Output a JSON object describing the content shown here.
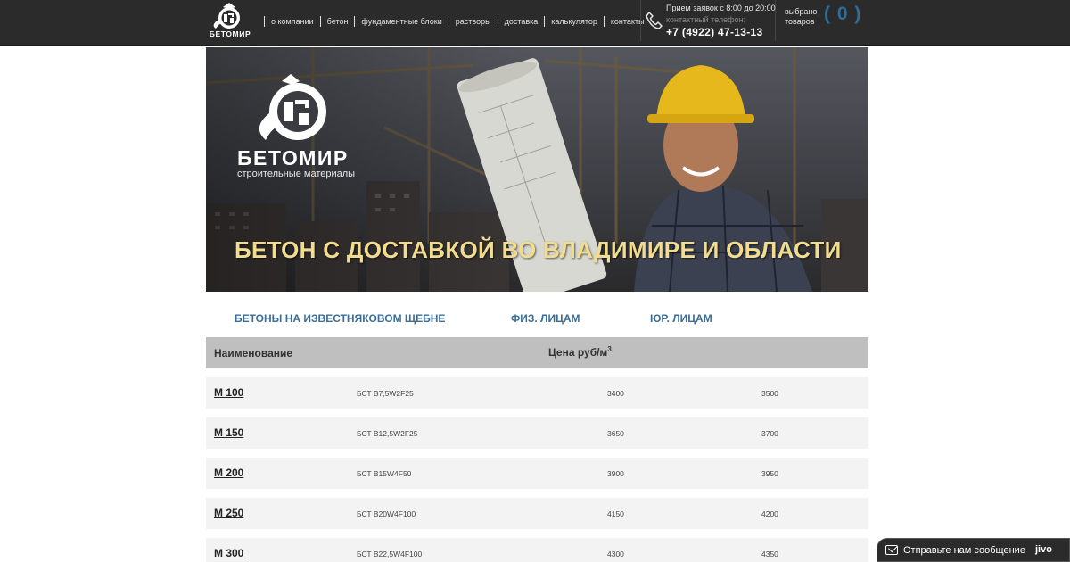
{
  "brand": {
    "name": "БЕТОМИР",
    "subtitle": "строительные материалы"
  },
  "nav": [
    {
      "label": "о компании"
    },
    {
      "label": "бетон"
    },
    {
      "label": "фундаментные блоки"
    },
    {
      "label": "растворы"
    },
    {
      "label": "доставка"
    },
    {
      "label": "калькулятор"
    },
    {
      "label": "контакты"
    }
  ],
  "contact": {
    "hours": "Прием заявок с 8:00 до 20:00",
    "label": "контактный телефон:",
    "phone": "+7 (4922) 47-13-13"
  },
  "cart": {
    "label_line1": "выбрано",
    "label_line2": "товаров",
    "count": "( 0 )"
  },
  "hero": {
    "title": "БЕТОН С ДОСТАВКОЙ ВО ВЛАДИМИРЕ И ОБЛАСТИ"
  },
  "tabs": [
    {
      "label": "БЕТОНЫ НА ИЗВЕСТНЯКОВОМ ЩЕБНЕ"
    },
    {
      "label": "ФИЗ. ЛИЦАМ"
    },
    {
      "label": "ЮР. ЛИЦАМ"
    }
  ],
  "table": {
    "col_name": "Наименование",
    "col_price": "Цена руб/м",
    "col_price_sup": "3",
    "rows": [
      {
        "name": "М 100",
        "code": "БСТ В7,5W2F25",
        "price_phys": "3400",
        "price_jur": "3500"
      },
      {
        "name": "М 150",
        "code": "БСТ В12,5W2F25",
        "price_phys": "3650",
        "price_jur": "3700"
      },
      {
        "name": "М 200",
        "code": "БСТ В15W4F50",
        "price_phys": "3900",
        "price_jur": "3950"
      },
      {
        "name": "М 250",
        "code": "БСТ В20W4F100",
        "price_phys": "4150",
        "price_jur": "4200"
      },
      {
        "name": "М 300",
        "code": "БСТ В22,5W4F100",
        "price_phys": "4300",
        "price_jur": "4350"
      }
    ]
  },
  "chat": {
    "label": "Отправьте нам сообщение",
    "brand": "jivo"
  },
  "colors": {
    "header_bg": "#2b2b2b",
    "accent_blue": "#3a6e98",
    "hero_title": "#f1dc8f",
    "table_head": "#bfbfbf",
    "row_bg": "#f3f3f3"
  },
  "icons": [
    "logo-emblem",
    "phone-icon",
    "message-icon"
  ]
}
